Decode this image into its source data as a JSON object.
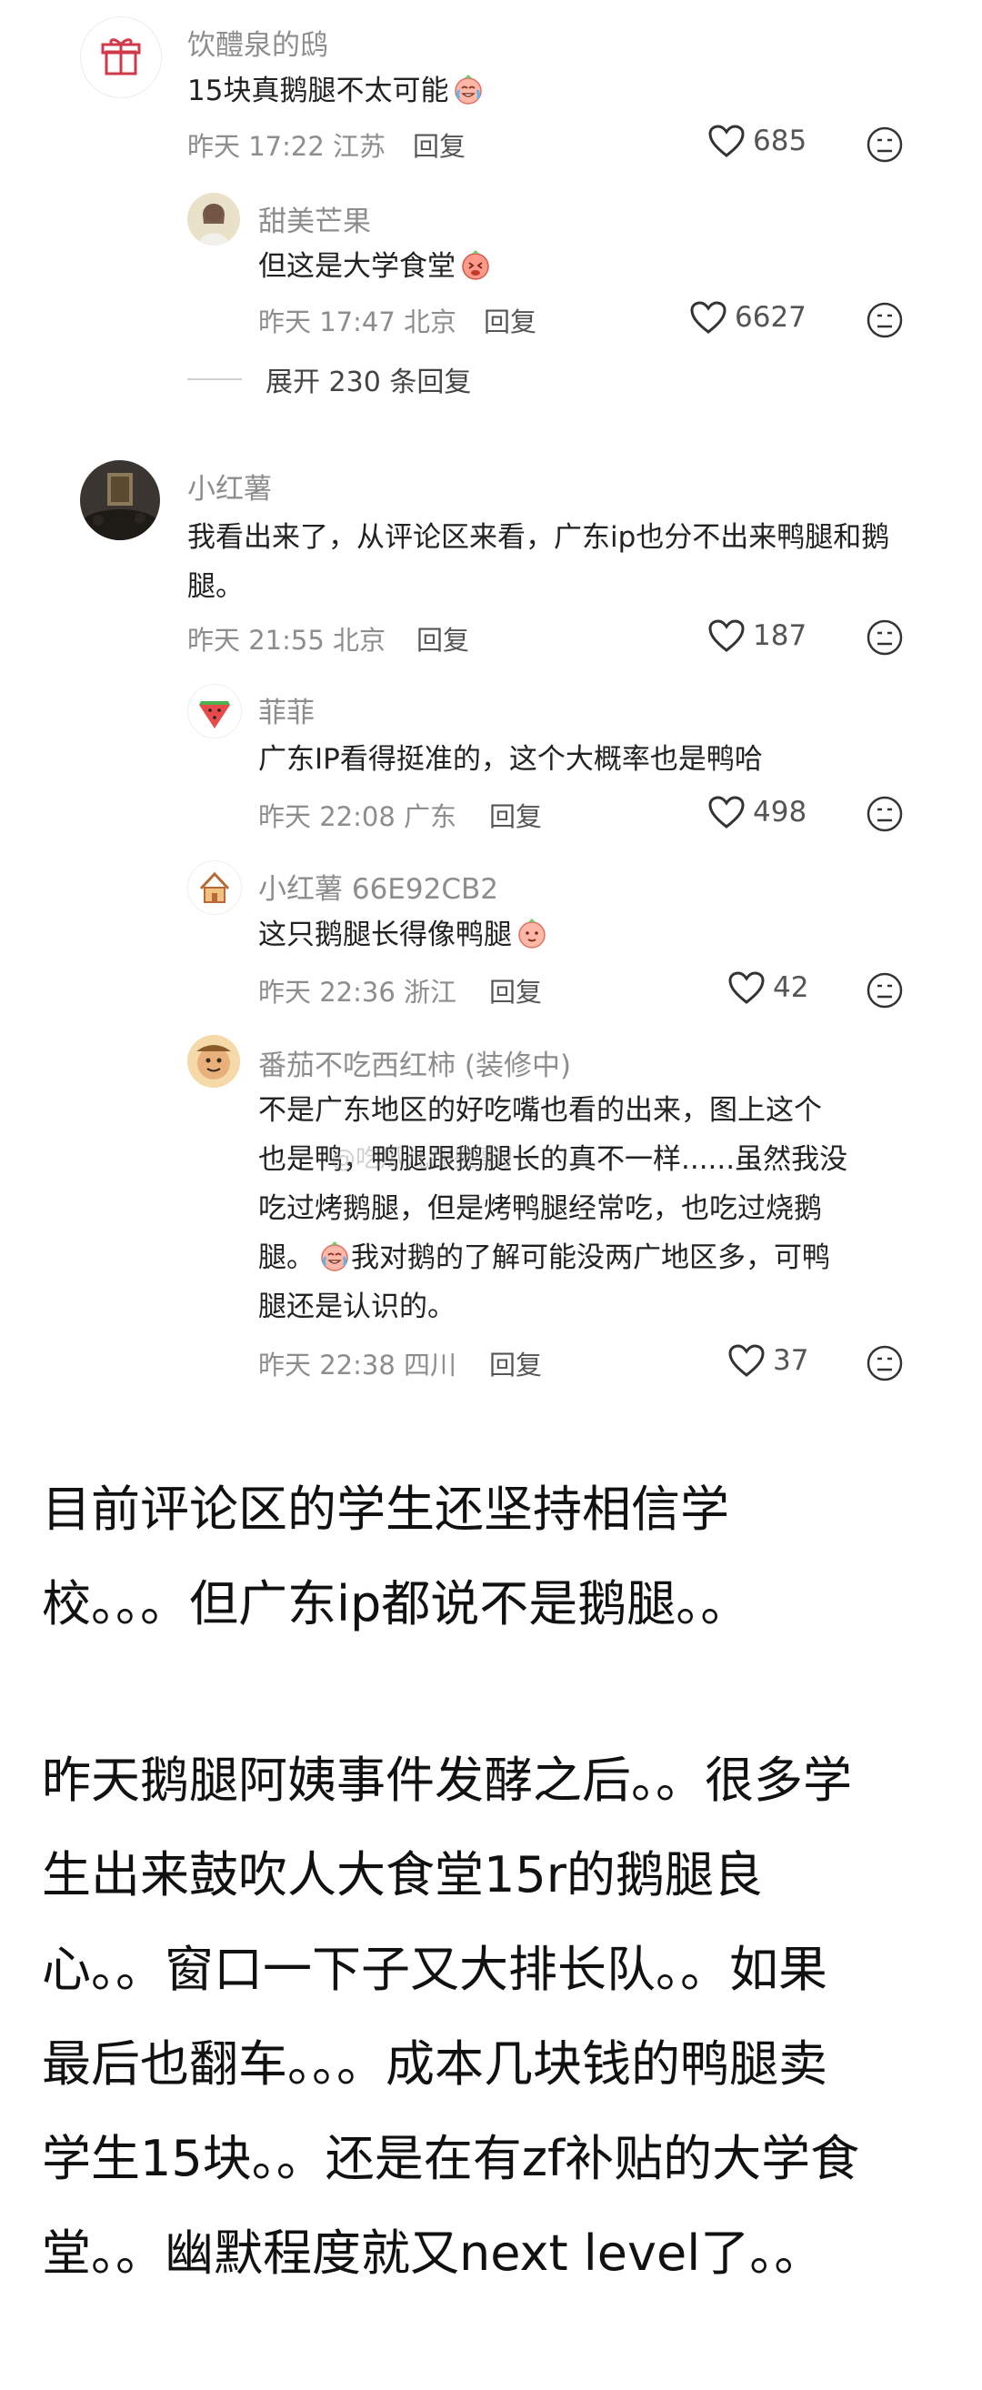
{
  "comments": [
    {
      "name": "饮醴泉的鸱",
      "text": "15块真鹅腿不太可能",
      "time": "昨天 17:22 江苏",
      "reply": "回复",
      "likes": "685",
      "emoji": "crying-laughing-emoji"
    },
    {
      "name": "甜美芒果",
      "text": "但这是大学食堂",
      "time": "昨天 17:47 北京",
      "reply": "回复",
      "likes": "6627",
      "emoji": "drooling-emoji"
    },
    {
      "name": "小红薯",
      "text": "我看出来了，从评论区来看，广东ip也分不出来鸭腿和鹅腿。",
      "time": "昨天 21:55 北京",
      "reply": "回复",
      "likes": "187"
    },
    {
      "name": "菲菲",
      "text": "广东IP看得挺准的，这个大概率也是鸭哈",
      "time": "昨天 22:08 广东",
      "reply": "回复",
      "likes": "498"
    },
    {
      "name": "小红薯 66E92CB2",
      "text": "这只鹅腿长得像鸭腿",
      "time": "昨天 22:36 浙江",
      "reply": "回复",
      "likes": "42",
      "emoji": "smirk-emoji"
    },
    {
      "name": "番茄不吃西红柿 (装修中)",
      "text_lines": [
        "不是广东地区的好吃嘴也看的出来，图上这个",
        "也是鸭，鸭腿跟鹅腿长的真不一样......虽然我没",
        "吃过烤鹅腿，但是烤鸭腿经常吃，也吃过烧鹅",
        "腿。",
        "我对鹅的了解可能没两广地区多，可鸭",
        "腿还是认识的。"
      ],
      "time": "昨天 22:38 四川",
      "reply": "回复",
      "likes": "37"
    }
  ],
  "expand_label": "展开 230 条回复",
  "watermark": "@吃瓜儿那些事儿",
  "post_paragraphs": [
    [
      "目前评论区的学生还坚持相信学",
      "校。。。但广东ip都说不是鹅腿。。"
    ],
    [
      "昨天鹅腿阿姨事件发酵之后。。很多学",
      "生出来鼓吹人大食堂15r的鹅腿良",
      "心。。窗口一下子又大排长队。。如果",
      "最后也翻车。。。成本几块钱的鸭腿卖",
      "学生15块。。还是在有zf补贴的大学食",
      "堂。。幽默程度就又next level了。。"
    ]
  ],
  "colors": {
    "meta": "#8d8d8d",
    "text": "#222222",
    "accent_red": "#e84a4a"
  }
}
